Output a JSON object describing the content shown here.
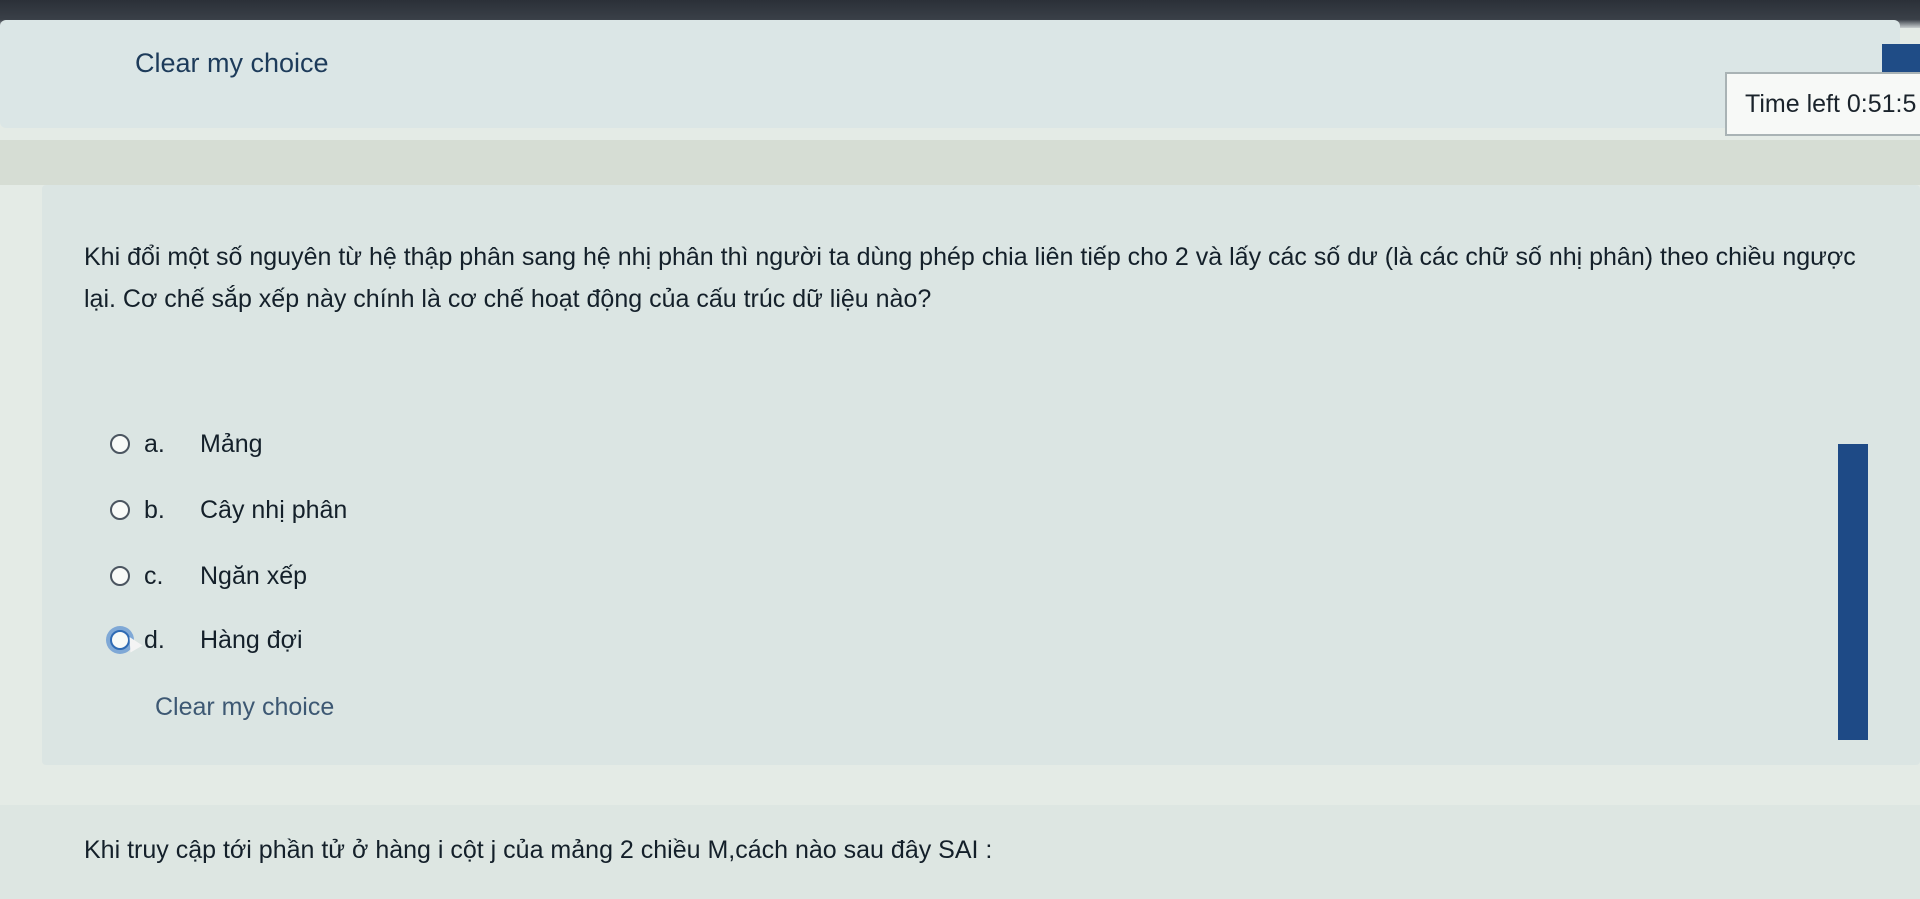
{
  "top": {
    "clear_choice_label": "Clear my choice"
  },
  "timer": {
    "label": "Time left 0:51:5"
  },
  "question": {
    "text": "Khi đổi một số nguyên từ hệ thập phân sang hệ nhị phân thì người ta dùng phép chia liên tiếp cho 2 và lấy các số dư (là các chữ số nhị phân) theo chiều ngược lại. Cơ chế sắp xếp này chính là cơ chế hoạt động của cấu trúc dữ liệu nào?",
    "options": [
      {
        "letter": "a.",
        "label": "Mảng"
      },
      {
        "letter": "b.",
        "label": "Cây nhị phân"
      },
      {
        "letter": "c.",
        "label": "Ngăn xếp"
      },
      {
        "letter": "d.",
        "label": "Hàng đợi"
      }
    ],
    "clear_choice_label": "Clear my choice"
  },
  "next_question": {
    "text": "Khi truy cập tới phần tử ở hàng i cột j của mảng 2 chiều M,cách nào sau đây SAI :"
  },
  "colors": {
    "accent": "#1e4a86",
    "link": "#1d3b5a"
  }
}
